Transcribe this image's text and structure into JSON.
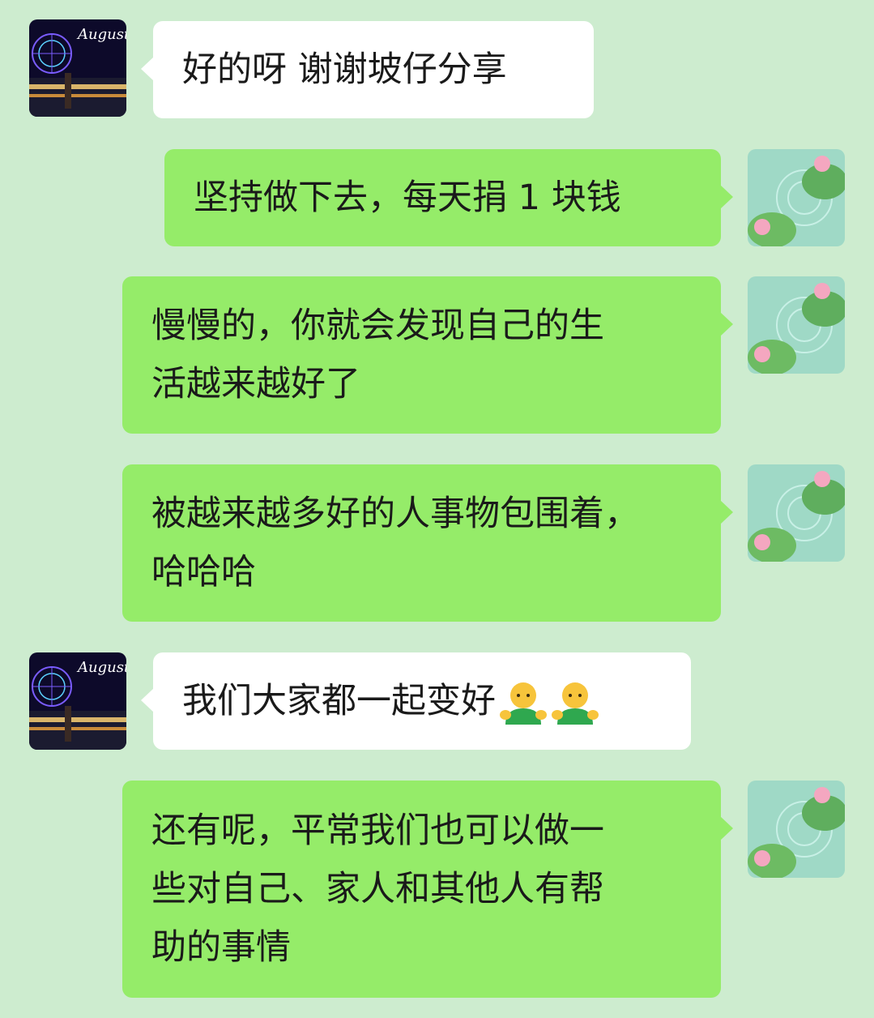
{
  "messages": [
    {
      "side": "left",
      "avatar": "ferris-wheel-night-avatar",
      "avatar_text": "August",
      "text": "好的呀 谢谢坡仔分享"
    },
    {
      "side": "right",
      "avatar": "lotus-pond-avatar",
      "text": "坚持做下去，每天捐 1 块钱"
    },
    {
      "side": "right",
      "avatar": "lotus-pond-avatar",
      "text": "慢慢的，你就会发现自己的生\n活越来越好了"
    },
    {
      "side": "right",
      "avatar": "lotus-pond-avatar",
      "text": "被越来越多好的人事物包围着，\n哈哈哈"
    },
    {
      "side": "left",
      "avatar": "ferris-wheel-night-avatar",
      "avatar_text": "August",
      "text": "我们大家都一起变好",
      "emojis": [
        "person-hugging-emoji",
        "person-hugging-emoji"
      ]
    },
    {
      "side": "right",
      "avatar": "lotus-pond-avatar",
      "text": "还有呢，平常我们也可以做一\n些对自己、家人和其他人有帮\n助的事情"
    }
  ],
  "colors": {
    "background": "#cdeccf",
    "incoming_bubble": "#ffffff",
    "outgoing_bubble": "#95ec69"
  }
}
